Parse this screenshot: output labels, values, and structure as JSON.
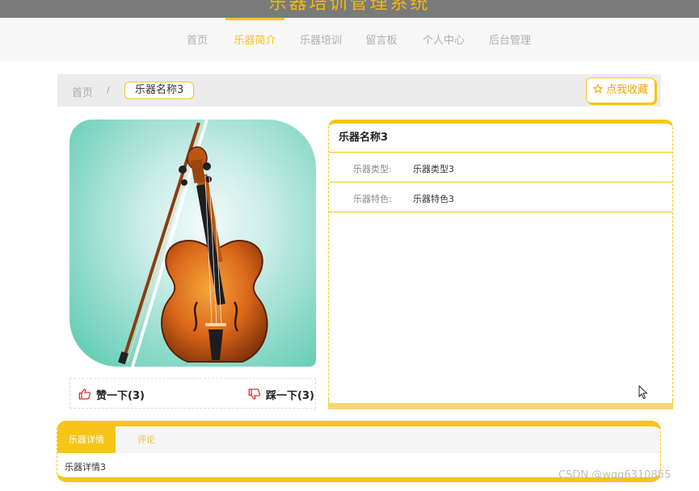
{
  "header": {
    "system_title": "乐器培训管理系统"
  },
  "nav": {
    "items": [
      {
        "label": "首页"
      },
      {
        "label": "乐器简介"
      },
      {
        "label": "乐器培训"
      },
      {
        "label": "留言板"
      },
      {
        "label": "个人中心"
      },
      {
        "label": "后台管理"
      }
    ],
    "active": "乐器简介"
  },
  "breadcrumb": {
    "home": "首页",
    "separator": "/",
    "current": "乐器名称3"
  },
  "favorite_button": {
    "icon": "star-outline-icon",
    "label": "点我收藏"
  },
  "product": {
    "image": "violin-with-bow-photo",
    "name": "乐器名称3",
    "fields": [
      {
        "label": "乐器类型:",
        "value": "乐器类型3"
      },
      {
        "label": "乐器特色:",
        "value": "乐器特色3"
      }
    ]
  },
  "votes": {
    "like_icon": "thumbs-up-icon",
    "like_label": "赞一下(3)",
    "dislike_icon": "thumbs-down-icon",
    "dislike_label": "踩一下(3)"
  },
  "detail": {
    "tabs": [
      {
        "label": "乐器详情"
      },
      {
        "label": "评论"
      }
    ],
    "active_tab": "乐器详情",
    "content": "乐器详情3"
  },
  "watermark": "CSDN @wqq6310855",
  "colors": {
    "accent": "#f5c518",
    "titlebar": "#7a7a7a",
    "nav_bg": "#f7f7f7",
    "crumb_bg": "#ececec"
  }
}
